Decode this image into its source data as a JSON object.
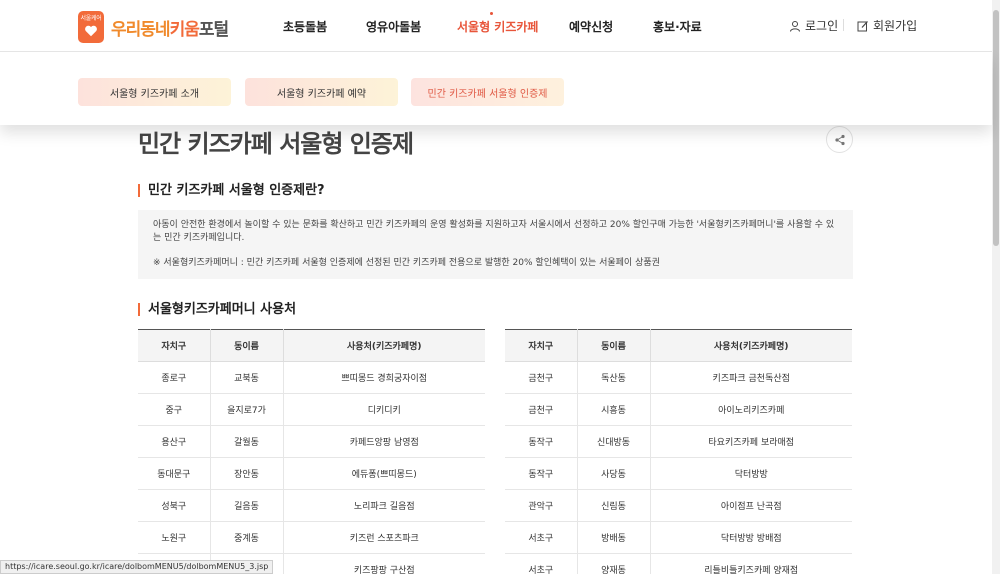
{
  "logo": {
    "small": "서울케어",
    "part1": "우리동네",
    "part2": "키움",
    "part3": "포털"
  },
  "nav": [
    {
      "label": "초등돌봄"
    },
    {
      "label": "영유아돌봄"
    },
    {
      "label": "서울형 키즈카페"
    },
    {
      "label": "예약신청"
    },
    {
      "label": "홍보·자료"
    }
  ],
  "util": {
    "login": "로그인",
    "signup": "회원가입"
  },
  "submenu": {
    "tabs": [
      {
        "label": "서울형 키즈카페 소개"
      },
      {
        "label": "서울형 키즈카페 예약"
      },
      {
        "label": "민간 키즈카페 서울형 인증제"
      }
    ]
  },
  "page": {
    "title": "민간 키즈카페 서울형 인증제",
    "section1_title": "민간 키즈카페 서울형 인증제란?",
    "info_p1": "아동이 안전한 환경에서 놀이할 수 있는 문화를 확산하고 민간 키즈카페의 운영 활성화를 지원하고자 서울시에서 선정하고 20% 할인구매 가능한 '서울형키즈카페머니'를 사용할 수 있는 민간 키즈카페입니다.",
    "info_p2": "※ 서울형키즈카페머니 : 민간 키즈카페 서울형 인증제에 선정된 민간 키즈카페 전용으로 발행한 20% 할인혜택이 있는 서울페이 상품권",
    "section2_title": "서울형키즈카페머니 사용처"
  },
  "table": {
    "headers": [
      "자치구",
      "동이름",
      "사용처(키즈카페명)"
    ],
    "left": [
      [
        "종로구",
        "교북동",
        "쁘띠몽드 경희궁자이점"
      ],
      [
        "중구",
        "을지로7가",
        "디키디키"
      ],
      [
        "용산구",
        "갈월동",
        "카페드앙팡 남영점"
      ],
      [
        "동대문구",
        "장안동",
        "에듀퐁(쁘띠몽드)"
      ],
      [
        "성북구",
        "길음동",
        "노리파크 길음점"
      ],
      [
        "노원구",
        "중계동",
        "키즈런 스포츠파크"
      ],
      [
        "",
        "강현동",
        "키즈팡팡 구산점"
      ]
    ],
    "right": [
      [
        "금천구",
        "독산동",
        "키즈파크 금천독산점"
      ],
      [
        "금천구",
        "시흥동",
        "아이노리키즈카페"
      ],
      [
        "동작구",
        "신대방동",
        "타요키즈카페 보라매점"
      ],
      [
        "동작구",
        "사당동",
        "닥터방방"
      ],
      [
        "관악구",
        "신림동",
        "아이점프 난곡점"
      ],
      [
        "서초구",
        "방배동",
        "닥터방방 방배점"
      ],
      [
        "서초구",
        "양재동",
        "리틀비틀키즈카페 양재점"
      ]
    ]
  },
  "status_url": "https://icare.seoul.go.kr/icare/dolbomMENU5/dolbomMENU5_3.jsp"
}
